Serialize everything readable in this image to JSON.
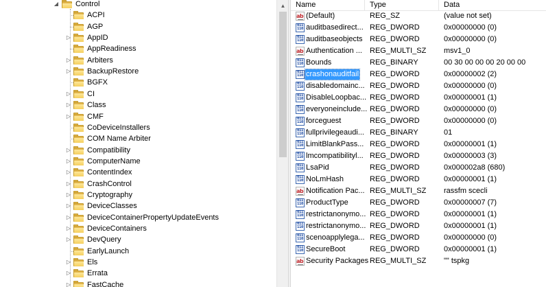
{
  "tree": {
    "root": {
      "label": "Control",
      "expander": "◢"
    },
    "children": [
      {
        "label": "ACPI",
        "expandable": false
      },
      {
        "label": "AGP",
        "expandable": false
      },
      {
        "label": "AppID",
        "expandable": true
      },
      {
        "label": "AppReadiness",
        "expandable": false
      },
      {
        "label": "Arbiters",
        "expandable": true
      },
      {
        "label": "BackupRestore",
        "expandable": true
      },
      {
        "label": "BGFX",
        "expandable": false
      },
      {
        "label": "CI",
        "expandable": true
      },
      {
        "label": "Class",
        "expandable": true
      },
      {
        "label": "CMF",
        "expandable": true
      },
      {
        "label": "CoDeviceInstallers",
        "expandable": false
      },
      {
        "label": "COM Name Arbiter",
        "expandable": false
      },
      {
        "label": "Compatibility",
        "expandable": true
      },
      {
        "label": "ComputerName",
        "expandable": true
      },
      {
        "label": "ContentIndex",
        "expandable": true
      },
      {
        "label": "CrashControl",
        "expandable": true
      },
      {
        "label": "Cryptography",
        "expandable": true
      },
      {
        "label": "DeviceClasses",
        "expandable": true
      },
      {
        "label": "DeviceContainerPropertyUpdateEvents",
        "expandable": true
      },
      {
        "label": "DeviceContainers",
        "expandable": true
      },
      {
        "label": "DevQuery",
        "expandable": true
      },
      {
        "label": "EarlyLaunch",
        "expandable": false
      },
      {
        "label": "Els",
        "expandable": true
      },
      {
        "label": "Errata",
        "expandable": true
      },
      {
        "label": "FastCache",
        "expandable": true
      }
    ]
  },
  "icons": {
    "collapsed": "▷",
    "folder": "folder-icon",
    "scroll_up": "▲"
  },
  "list": {
    "headers": {
      "name": "Name",
      "type": "Type",
      "data": "Data"
    },
    "rows": [
      {
        "icon": "string",
        "name": "(Default)",
        "type": "REG_SZ",
        "data": "(value not set)"
      },
      {
        "icon": "binary",
        "name": "auditbasedirect...",
        "type": "REG_DWORD",
        "data": "0x00000000 (0)"
      },
      {
        "icon": "binary",
        "name": "auditbaseobjects",
        "type": "REG_DWORD",
        "data": "0x00000000 (0)"
      },
      {
        "icon": "string",
        "name": "Authentication ...",
        "type": "REG_MULTI_SZ",
        "data": "msv1_0"
      },
      {
        "icon": "binary",
        "name": "Bounds",
        "type": "REG_BINARY",
        "data": "00 30 00 00 00 20 00 00"
      },
      {
        "icon": "binary",
        "name": "crashonauditfail",
        "type": "REG_DWORD",
        "data": "0x00000002 (2)",
        "selected": true
      },
      {
        "icon": "binary",
        "name": "disabledomainc...",
        "type": "REG_DWORD",
        "data": "0x00000000 (0)"
      },
      {
        "icon": "binary",
        "name": "DisableLoopbac...",
        "type": "REG_DWORD",
        "data": "0x00000001 (1)"
      },
      {
        "icon": "binary",
        "name": "everyoneinclude...",
        "type": "REG_DWORD",
        "data": "0x00000000 (0)"
      },
      {
        "icon": "binary",
        "name": "forceguest",
        "type": "REG_DWORD",
        "data": "0x00000000 (0)"
      },
      {
        "icon": "binary",
        "name": "fullprivilegeaudi...",
        "type": "REG_BINARY",
        "data": "01"
      },
      {
        "icon": "binary",
        "name": "LimitBlankPass...",
        "type": "REG_DWORD",
        "data": "0x00000001 (1)"
      },
      {
        "icon": "binary",
        "name": "lmcompatibilityl...",
        "type": "REG_DWORD",
        "data": "0x00000003 (3)"
      },
      {
        "icon": "binary",
        "name": "LsaPid",
        "type": "REG_DWORD",
        "data": "0x000002a8 (680)"
      },
      {
        "icon": "binary",
        "name": "NoLmHash",
        "type": "REG_DWORD",
        "data": "0x00000001 (1)"
      },
      {
        "icon": "string",
        "name": "Notification Pac...",
        "type": "REG_MULTI_SZ",
        "data": "rassfm scecli"
      },
      {
        "icon": "binary",
        "name": "ProductType",
        "type": "REG_DWORD",
        "data": "0x00000007 (7)"
      },
      {
        "icon": "binary",
        "name": "restrictanonymo...",
        "type": "REG_DWORD",
        "data": "0x00000001 (1)"
      },
      {
        "icon": "binary",
        "name": "restrictanonymo...",
        "type": "REG_DWORD",
        "data": "0x00000001 (1)"
      },
      {
        "icon": "binary",
        "name": "scenoapplylega...",
        "type": "REG_DWORD",
        "data": "0x00000000 (0)"
      },
      {
        "icon": "binary",
        "name": "SecureBoot",
        "type": "REG_DWORD",
        "data": "0x00000001 (1)"
      },
      {
        "icon": "string",
        "name": "Security Packages",
        "type": "REG_MULTI_SZ",
        "data": "\"\" tspkg"
      }
    ]
  },
  "colors": {
    "selection": "#3399ff",
    "folder": "#e3b64c",
    "string_icon": "#c0282d",
    "binary_icon": "#0a3c9c"
  }
}
